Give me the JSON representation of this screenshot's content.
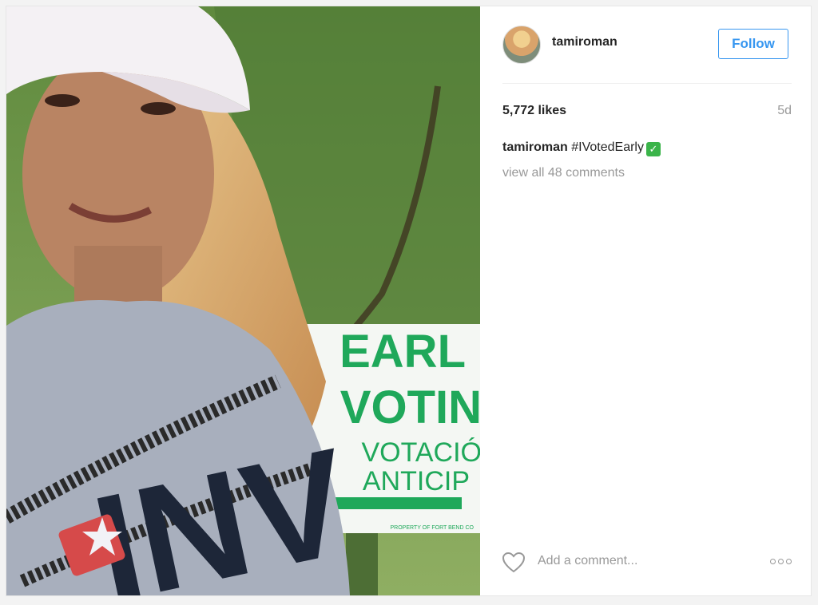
{
  "post": {
    "username": "tamiroman",
    "follow_label": "Follow",
    "likes": "5,772 likes",
    "time_ago": "5d",
    "caption_user": "tamiroman",
    "caption_text": " #IVotedEarly",
    "caption_emoji": "✓",
    "view_comments": "view all 48 comments",
    "add_comment_placeholder": "Add a comment...",
    "photo": {
      "sign_lines": [
        "EARL",
        "VOTIN",
        "VOTACIÓ",
        "ANTICIP"
      ],
      "sign_footer": "PROPERTY OF FORT BEND CO",
      "shirt_text": "INV"
    }
  },
  "colors": {
    "accent": "#3897f0",
    "sign_green": "#1fa85a",
    "muted": "#999999"
  },
  "icons": {
    "like": "heart-outline-icon",
    "more": "ellipsis-icon",
    "check": "check-mark-emoji-icon"
  }
}
